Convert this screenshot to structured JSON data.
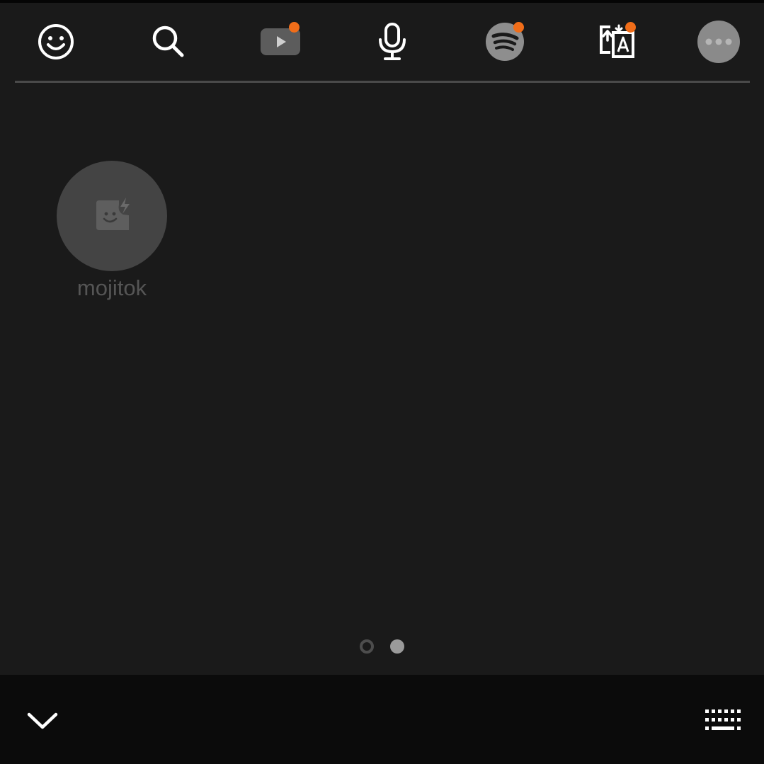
{
  "toolbar": {
    "items": [
      {
        "id": "emoji",
        "icon": "smiley-icon",
        "badge": false
      },
      {
        "id": "search",
        "icon": "search-icon",
        "badge": false
      },
      {
        "id": "youtube",
        "icon": "youtube-icon",
        "badge": true
      },
      {
        "id": "voice",
        "icon": "microphone-icon",
        "badge": false
      },
      {
        "id": "spotify",
        "icon": "spotify-icon",
        "badge": true
      },
      {
        "id": "translate",
        "icon": "translate-icon",
        "badge": true
      },
      {
        "id": "more",
        "icon": "more-icon",
        "badge": false
      }
    ]
  },
  "apps": [
    {
      "label": "mojitok",
      "icon": "mojitok-icon"
    }
  ],
  "pager": {
    "total": 2,
    "active_index": 1
  },
  "bottom_bar": {
    "left_icon": "chevron-down-icon",
    "right_icon": "keyboard-icon"
  },
  "colors": {
    "background": "#1a1a1a",
    "bottom_bar": "#0b0b0b",
    "badge": "#f06d19",
    "icon": "#ffffff",
    "muted_icon": "#9a9a9a",
    "app_circle": "#444444",
    "app_label": "#555555"
  }
}
